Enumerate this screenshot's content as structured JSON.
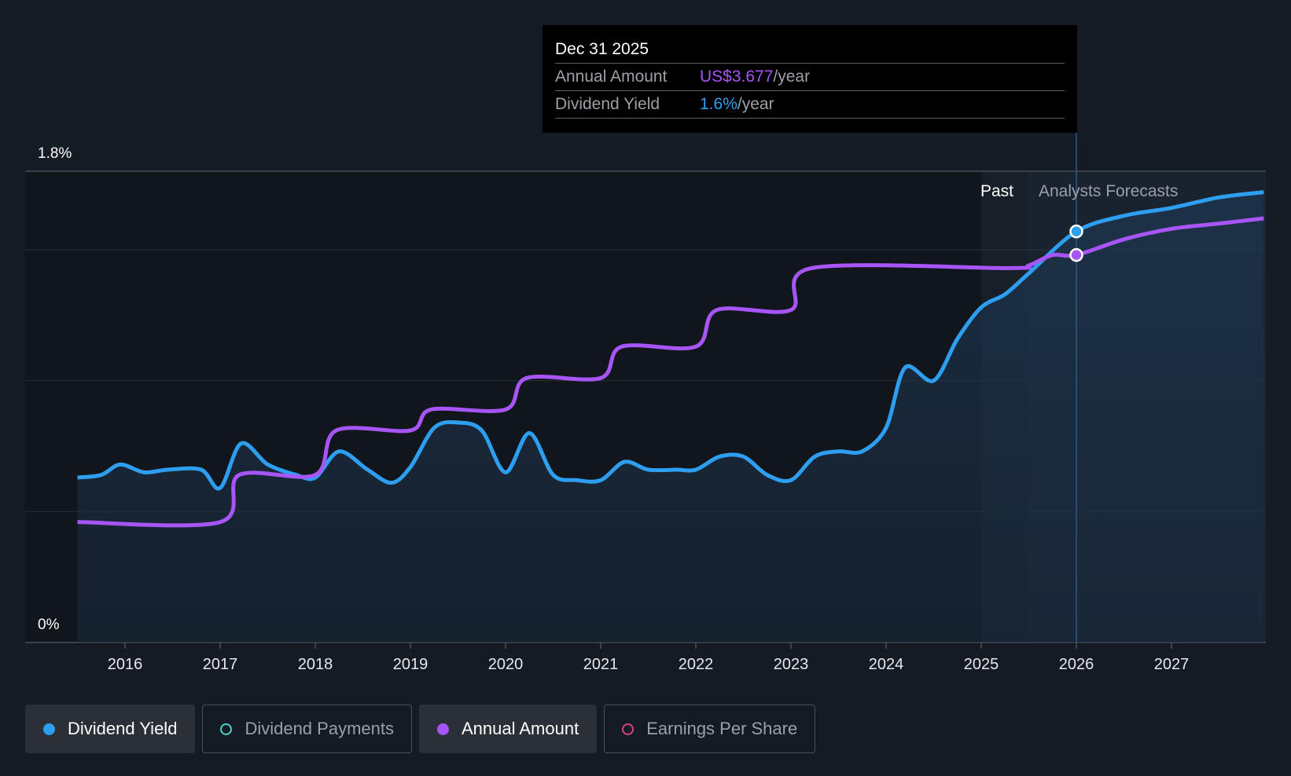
{
  "tooltip": {
    "date": "Dec 31 2025",
    "annual_label": "Annual Amount",
    "annual_value": "US$3.677",
    "annual_unit": "/year",
    "yield_label": "Dividend Yield",
    "yield_value": "1.6%",
    "yield_unit": "/year"
  },
  "regions": {
    "past_label": "Past",
    "forecast_label": "Analysts Forecasts"
  },
  "legend": [
    {
      "label": "Dividend Yield",
      "color": "#2d9ef0",
      "filled": true,
      "active": true
    },
    {
      "label": "Dividend Payments",
      "color": "#4fd1c5",
      "filled": false,
      "active": false
    },
    {
      "label": "Annual Amount",
      "color": "#a855f7",
      "filled": true,
      "active": true
    },
    {
      "label": "Earnings Per Share",
      "color": "#d6457a",
      "filled": false,
      "active": false
    }
  ],
  "colors": {
    "yield": "#2d9ef0",
    "annual": "#a855f7",
    "background": "#151b24",
    "plot_bg": "#11151c"
  },
  "chart_data": {
    "type": "line",
    "x_ticks": [
      "2016",
      "2017",
      "2018",
      "2019",
      "2020",
      "2021",
      "2022",
      "2023",
      "2024",
      "2025",
      "2026",
      "2027"
    ],
    "y_tick_labels": [
      "1.8%",
      "0%"
    ],
    "ylim": [
      0,
      1.8
    ],
    "xlim": [
      2015.0,
      2028.0
    ],
    "past_end": 2025.0,
    "forecast_start": 2025.48,
    "highlight_x": 2026.0,
    "grid": true,
    "series": [
      {
        "name": "Dividend Yield",
        "unit": "%",
        "points": [
          [
            2015.5,
            0.63
          ],
          [
            2015.75,
            0.64
          ],
          [
            2015.95,
            0.68
          ],
          [
            2016.2,
            0.65
          ],
          [
            2016.45,
            0.66
          ],
          [
            2016.8,
            0.66
          ],
          [
            2017.0,
            0.59
          ],
          [
            2017.22,
            0.76
          ],
          [
            2017.5,
            0.68
          ],
          [
            2017.8,
            0.64
          ],
          [
            2018.0,
            0.63
          ],
          [
            2018.25,
            0.73
          ],
          [
            2018.55,
            0.66
          ],
          [
            2018.8,
            0.61
          ],
          [
            2019.0,
            0.67
          ],
          [
            2019.25,
            0.82
          ],
          [
            2019.5,
            0.84
          ],
          [
            2019.75,
            0.81
          ],
          [
            2020.0,
            0.65
          ],
          [
            2020.25,
            0.8
          ],
          [
            2020.5,
            0.64
          ],
          [
            2020.75,
            0.62
          ],
          [
            2021.0,
            0.62
          ],
          [
            2021.25,
            0.69
          ],
          [
            2021.5,
            0.66
          ],
          [
            2021.8,
            0.66
          ],
          [
            2022.0,
            0.66
          ],
          [
            2022.25,
            0.71
          ],
          [
            2022.5,
            0.71
          ],
          [
            2022.75,
            0.64
          ],
          [
            2023.0,
            0.62
          ],
          [
            2023.25,
            0.71
          ],
          [
            2023.5,
            0.73
          ],
          [
            2023.75,
            0.73
          ],
          [
            2024.0,
            0.82
          ],
          [
            2024.2,
            1.05
          ],
          [
            2024.5,
            1.0
          ],
          [
            2024.75,
            1.16
          ],
          [
            2025.0,
            1.28
          ],
          [
            2025.25,
            1.33
          ],
          [
            2025.5,
            1.41
          ],
          [
            2026.0,
            1.57
          ],
          [
            2026.5,
            1.63
          ],
          [
            2027.0,
            1.66
          ],
          [
            2027.5,
            1.7
          ],
          [
            2027.97,
            1.72
          ]
        ]
      },
      {
        "name": "Annual Amount",
        "unit": "US$",
        "points": [
          [
            2015.5,
            0.46
          ],
          [
            2017.0,
            0.46
          ],
          [
            2017.2,
            0.64
          ],
          [
            2018.0,
            0.64
          ],
          [
            2018.22,
            0.81
          ],
          [
            2019.0,
            0.81
          ],
          [
            2019.22,
            0.89
          ],
          [
            2020.0,
            0.89
          ],
          [
            2020.22,
            1.01
          ],
          [
            2021.0,
            1.01
          ],
          [
            2021.22,
            1.13
          ],
          [
            2022.0,
            1.13
          ],
          [
            2022.22,
            1.27
          ],
          [
            2023.0,
            1.27
          ],
          [
            2023.22,
            1.43
          ],
          [
            2025.3,
            1.43
          ],
          [
            2025.5,
            1.44
          ],
          [
            2025.75,
            1.48
          ],
          [
            2026.0,
            1.48
          ],
          [
            2026.5,
            1.54
          ],
          [
            2027.0,
            1.58
          ],
          [
            2027.5,
            1.6
          ],
          [
            2027.97,
            1.62
          ]
        ]
      }
    ],
    "markers": [
      {
        "series": "Dividend Yield",
        "x": 2026.0,
        "y": 1.57
      },
      {
        "series": "Annual Amount",
        "x": 2026.0,
        "y": 1.48
      }
    ]
  }
}
